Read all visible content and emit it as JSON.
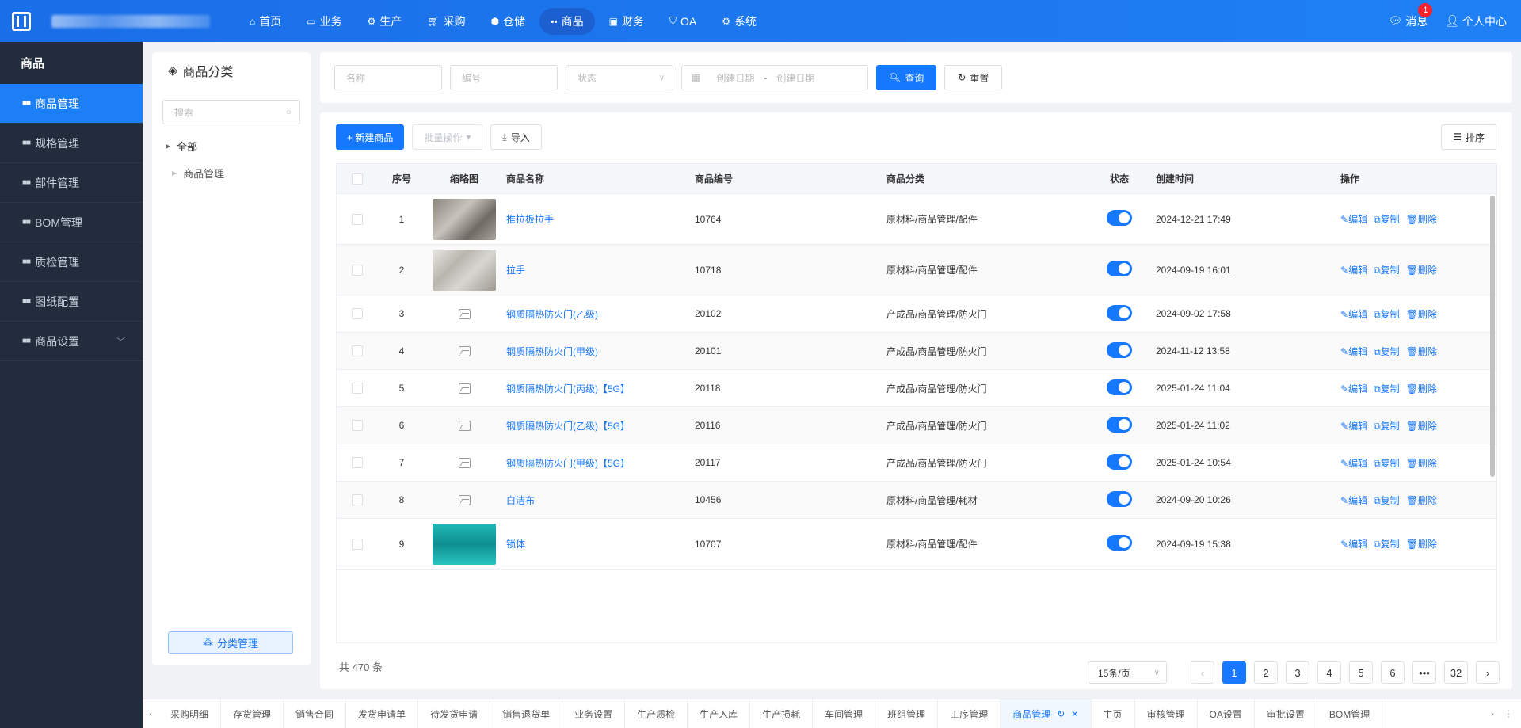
{
  "topnav": {
    "items": [
      {
        "icon": "home-icon",
        "label": "首页"
      },
      {
        "icon": "card-icon",
        "label": "业务"
      },
      {
        "icon": "factory-icon",
        "label": "生产"
      },
      {
        "icon": "cart-icon",
        "label": "采购"
      },
      {
        "icon": "box-icon",
        "label": "仓储"
      },
      {
        "icon": "grid-icon",
        "label": "商品"
      },
      {
        "icon": "finance-icon",
        "label": "财务"
      },
      {
        "icon": "shield-icon",
        "label": "OA"
      },
      {
        "icon": "settings-icon",
        "label": "系统"
      }
    ],
    "active_index": 5,
    "messages_label": "消息",
    "messages_badge": "1",
    "profile_label": "个人中心"
  },
  "sidebar": {
    "title": "商品",
    "items": [
      {
        "label": "商品管理",
        "active": true
      },
      {
        "label": "规格管理"
      },
      {
        "label": "部件管理"
      },
      {
        "label": "BOM管理"
      },
      {
        "label": "质检管理"
      },
      {
        "label": "图纸配置"
      },
      {
        "label": "商品设置",
        "expandable": true
      }
    ]
  },
  "category": {
    "title": "商品分类",
    "search_placeholder": "搜索",
    "tree": [
      {
        "label": "全部"
      },
      {
        "label": "商品管理"
      }
    ],
    "manage_button": "分类管理"
  },
  "filters": {
    "name_placeholder": "名称",
    "code_placeholder": "编号",
    "status_placeholder": "状态",
    "date_start_placeholder": "创建日期",
    "date_sep": "-",
    "date_end_placeholder": "创建日期",
    "query_label": "查询",
    "reset_label": "重置"
  },
  "toolbar": {
    "new_label": "+ 新建商品",
    "batch_label": "批量操作",
    "import_label": "导入",
    "sort_label": "排序"
  },
  "table": {
    "headers": {
      "index": "序号",
      "thumb": "缩略图",
      "name": "商品名称",
      "code": "商品编号",
      "category": "商品分类",
      "status": "状态",
      "created": "创建时间",
      "ops": "操作"
    },
    "op_labels": {
      "edit": "编辑",
      "copy": "复制",
      "delete": "删除"
    },
    "rows": [
      {
        "index": "1",
        "thumb": "photo-1",
        "name": "推拉板拉手",
        "code": "10764",
        "category": "原材料/商品管理/配件",
        "status": true,
        "created": "2024-12-21 17:49"
      },
      {
        "index": "2",
        "thumb": "photo-2",
        "name": "拉手",
        "code": "10718",
        "category": "原材料/商品管理/配件",
        "status": true,
        "created": "2024-09-19 16:01"
      },
      {
        "index": "3",
        "thumb": "none",
        "name": "钢质隔热防火门(乙级)",
        "code": "20102",
        "category": "产成品/商品管理/防火门",
        "status": true,
        "created": "2024-09-02 17:58"
      },
      {
        "index": "4",
        "thumb": "none",
        "name": "钢质隔热防火门(甲级)",
        "code": "20101",
        "category": "产成品/商品管理/防火门",
        "status": true,
        "created": "2024-11-12 13:58"
      },
      {
        "index": "5",
        "thumb": "none",
        "name": "钢质隔热防火门(丙级)【5G】",
        "code": "20118",
        "category": "产成品/商品管理/防火门",
        "status": true,
        "created": "2025-01-24 11:04"
      },
      {
        "index": "6",
        "thumb": "none",
        "name": "钢质隔热防火门(乙级)【5G】",
        "code": "20116",
        "category": "产成品/商品管理/防火门",
        "status": true,
        "created": "2025-01-24 11:02"
      },
      {
        "index": "7",
        "thumb": "none",
        "name": "钢质隔热防火门(甲级)【5G】",
        "code": "20117",
        "category": "产成品/商品管理/防火门",
        "status": true,
        "created": "2025-01-24 10:54"
      },
      {
        "index": "8",
        "thumb": "none",
        "name": "白洁布",
        "code": "10456",
        "category": "原材料/商品管理/耗材",
        "status": true,
        "created": "2024-09-20 10:26"
      },
      {
        "index": "9",
        "thumb": "photo-3",
        "name": "锁体",
        "code": "10707",
        "category": "原材料/商品管理/配件",
        "status": true,
        "created": "2024-09-19 15:38"
      }
    ]
  },
  "pagination": {
    "total_label": "共 470 条",
    "page_size": "15条/页",
    "pages": [
      "1",
      "2",
      "3",
      "4",
      "5",
      "6",
      "•••",
      "32"
    ],
    "current": "1"
  },
  "tabs": {
    "items": [
      "采购明细",
      "存货管理",
      "销售合同",
      "发货申请单",
      "待发货申请",
      "销售退货单",
      "业务设置",
      "生产质检",
      "生产入库",
      "生产损耗",
      "车间管理",
      "班组管理",
      "工序管理",
      "商品管理",
      "主页",
      "审核管理",
      "OA设置",
      "审批设置",
      "BOM管理"
    ],
    "active_index": 13
  },
  "colors": {
    "primary": "#1677ff",
    "sidebar_bg": "#222c3c",
    "topbar_bg": "#1f80f5"
  }
}
